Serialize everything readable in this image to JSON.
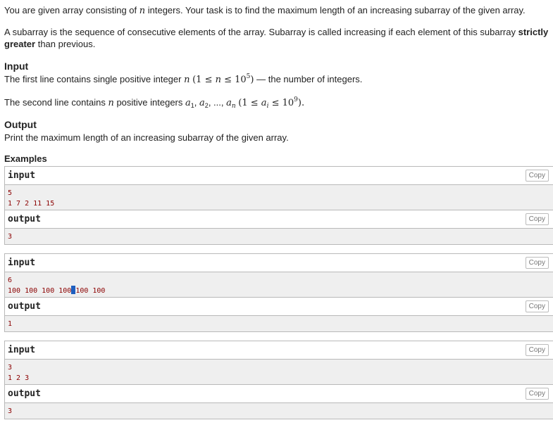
{
  "statement": {
    "intro": "You are given array consisting of n integers. Your task is to find the maximum length of an increasing subarray of the given array.",
    "subarray_a": "A subarray is the sequence of consecutive elements of the array. Subarray is called increasing if each element of this subarray",
    "strictly_greater": "strictly greater",
    "subarray_b": "than previous."
  },
  "input_section": {
    "title": "Input",
    "line1_a": "The first line contains single positive integer",
    "line1_b": "— the number of integers.",
    "line2_a": "The second line contains",
    "line2_b": "positive integers"
  },
  "output_section": {
    "title": "Output",
    "text": "Print the maximum length of an increasing subarray of the given array."
  },
  "examples": {
    "title": "Examples",
    "copy_label": "Copy",
    "input_label": "input",
    "output_label": "output",
    "tests": [
      {
        "input": [
          "5",
          "1 7 2 11 15"
        ],
        "output": [
          "3"
        ]
      },
      {
        "input": [
          "6",
          "100 100 100 100",
          "100 100"
        ],
        "output": [
          "1"
        ]
      },
      {
        "input": [
          "3",
          "1 2 3"
        ],
        "output": [
          "3"
        ]
      }
    ]
  }
}
